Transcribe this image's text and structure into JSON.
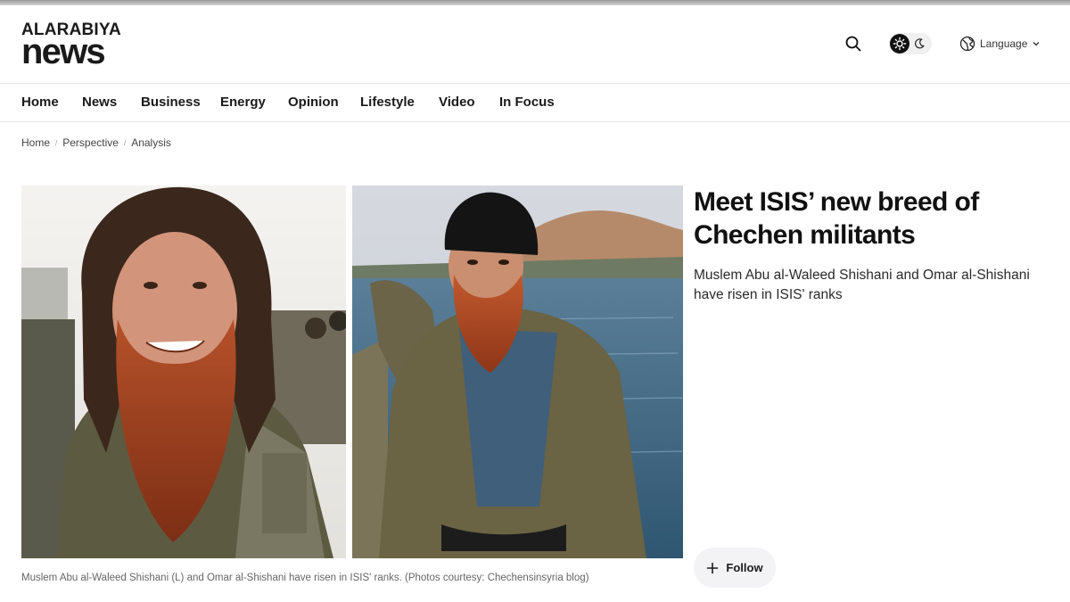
{
  "brand": {
    "logo_top": "ALARABIYA",
    "logo_bottom": "news"
  },
  "header": {
    "search_icon": "search-icon",
    "theme_icons": [
      "sun-icon",
      "moon-icon"
    ],
    "language_label": "Language"
  },
  "nav": {
    "items": [
      "Home",
      "News",
      "Business",
      "Energy",
      "Opinion",
      "Lifestyle",
      "Video",
      "In Focus"
    ]
  },
  "breadcrumb": {
    "items": [
      "Home",
      "Perspective",
      "Analysis"
    ]
  },
  "article": {
    "headline": "Meet ISIS’ new breed of Chechen militants",
    "subhead": "Muslem Abu al-Waleed Shishani and Omar al-Shishani have risen in ISIS' ranks",
    "caption": "Muslem Abu al-Waleed Shishani (L) and Omar al-Shishani have risen in ISIS' ranks. (Photos courtesy: Chechensinsyria blog)",
    "follow_label": "Follow"
  },
  "colors": {
    "accent": "#111111",
    "follow_bg": "#f3f3f5",
    "nav_border": "#e6e6e6"
  }
}
